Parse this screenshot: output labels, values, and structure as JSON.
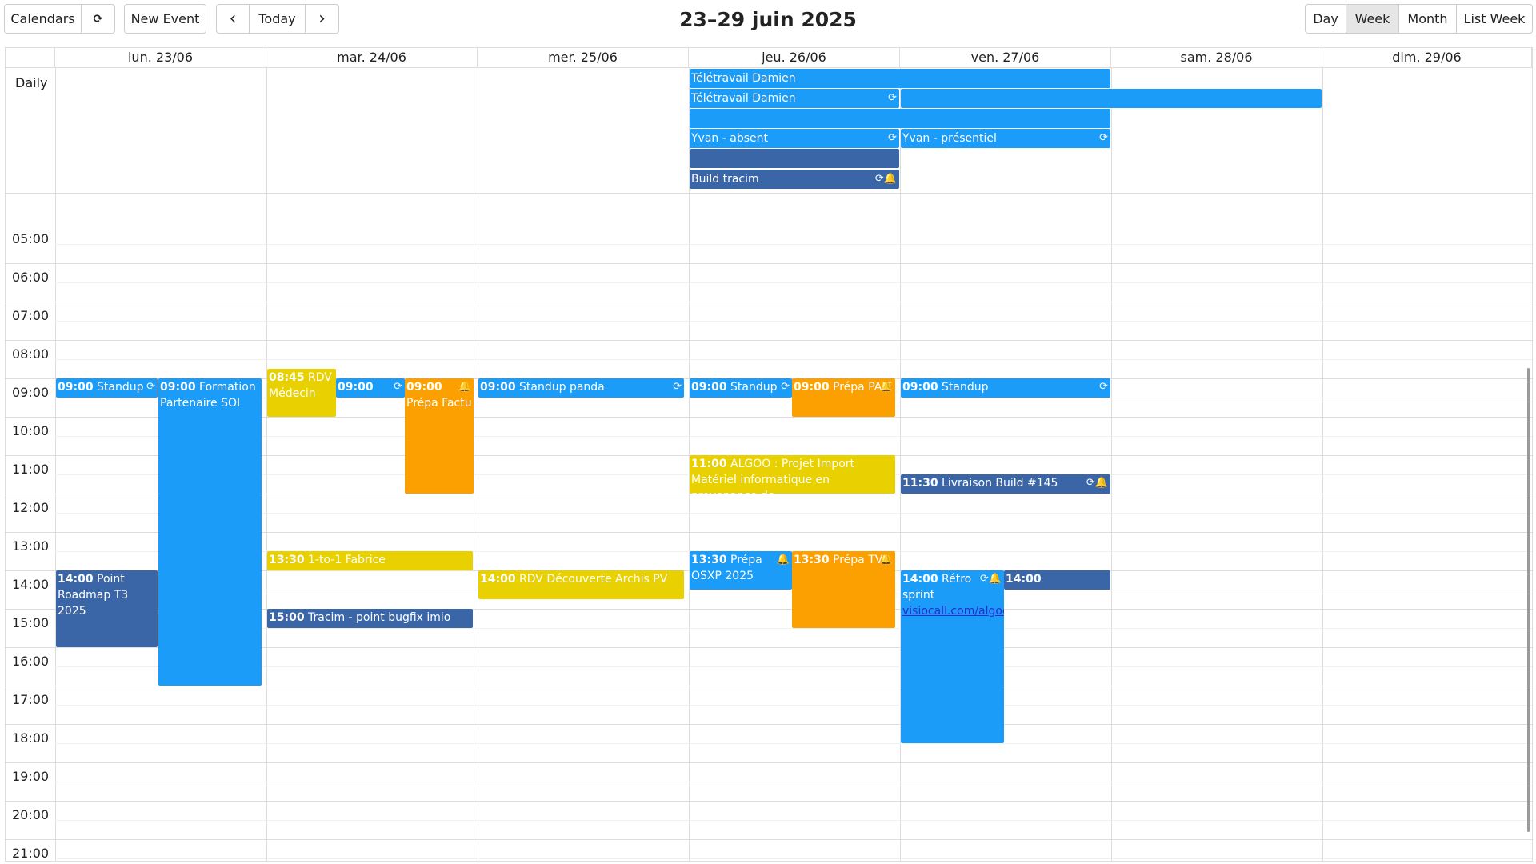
{
  "toolbar": {
    "calendars": "Calendars",
    "refresh_icon": "⟳",
    "new_event": "New Event",
    "prev_icon": "‹",
    "today": "Today",
    "next_icon": "›",
    "views": [
      "Day",
      "Week",
      "Month",
      "List Week"
    ],
    "active_view": "Week"
  },
  "title": "23–29 juin 2025",
  "days": [
    "lun. 23/06",
    "mar. 24/06",
    "mer. 25/06",
    "jeu. 26/06",
    "ven. 27/06",
    "sam. 28/06",
    "dim. 29/06"
  ],
  "daily_label": "Daily",
  "hours": [
    "05:00",
    "06:00",
    "07:00",
    "08:00",
    "09:00",
    "10:00",
    "11:00",
    "12:00",
    "13:00",
    "14:00",
    "15:00",
    "16:00",
    "17:00",
    "18:00",
    "19:00",
    "20:00",
    "21:00"
  ],
  "all_day_events": [
    {
      "title": "Télétravail Damien",
      "flags": ""
    },
    {
      "title": "Télétravail Damien",
      "flags": "⟳"
    },
    {
      "title": "",
      "flags": ""
    },
    {
      "title": "",
      "flags": ""
    },
    {
      "title": "Yvan - absent",
      "flags": "⟳"
    },
    {
      "title": "Yvan - présentiel",
      "flags": "⟳"
    },
    {
      "title": "",
      "flags": ""
    },
    {
      "title": "Build tracim",
      "flags": "⟳🔔"
    }
  ],
  "events": [
    {
      "time": "09:00",
      "title": "Standup",
      "flags": "⟳"
    },
    {
      "time": "09:00",
      "title": "Formation Partenaire SOI",
      "flags": ""
    },
    {
      "time": "14:00",
      "title": "Point Roadmap T3 2025",
      "flags": ""
    },
    {
      "time": "08:45",
      "title": "RDV Médecin",
      "flags": ""
    },
    {
      "time": "09:00",
      "title": "",
      "flags": "⟳"
    },
    {
      "time": "09:00",
      "title": "Prépa Factu",
      "flags": "🔔"
    },
    {
      "time": "13:30",
      "title": "1-to-1 Fabrice",
      "flags": ""
    },
    {
      "time": "15:00",
      "title": "Tracim - point bugfix imio",
      "flags": ""
    },
    {
      "time": "09:00",
      "title": "Standup panda",
      "flags": "⟳"
    },
    {
      "time": "14:00",
      "title": "RDV Découverte Archis PV",
      "flags": ""
    },
    {
      "time": "09:00",
      "title": "Standup",
      "flags": "⟳"
    },
    {
      "time": "09:00",
      "title": "Prépa PAIE",
      "flags": "🔔"
    },
    {
      "time": "11:00",
      "title": "ALGOO : Projet Import Matériel informatique en provenance de",
      "flags": ""
    },
    {
      "time": "13:30",
      "title": "Prépa OSXP 2025",
      "flags": "🔔"
    },
    {
      "time": "13:30",
      "title": "Prépa TVA",
      "flags": "🔔"
    },
    {
      "time": "09:00",
      "title": "Standup",
      "flags": "⟳"
    },
    {
      "time": "11:30",
      "title": "Livraison Build #145",
      "flags": "⟳🔔"
    },
    {
      "time": "14:00",
      "title": "Rétro sprint",
      "flags": "⟳🔔",
      "link": "visiocall.com/algoo"
    },
    {
      "time": "14:00",
      "title": "",
      "flags": ""
    }
  ],
  "colors": {
    "blue": "#1a9cf8",
    "dark_blue": "#3a66a8",
    "orange": "#fba000",
    "yellow": "#e9d000"
  }
}
